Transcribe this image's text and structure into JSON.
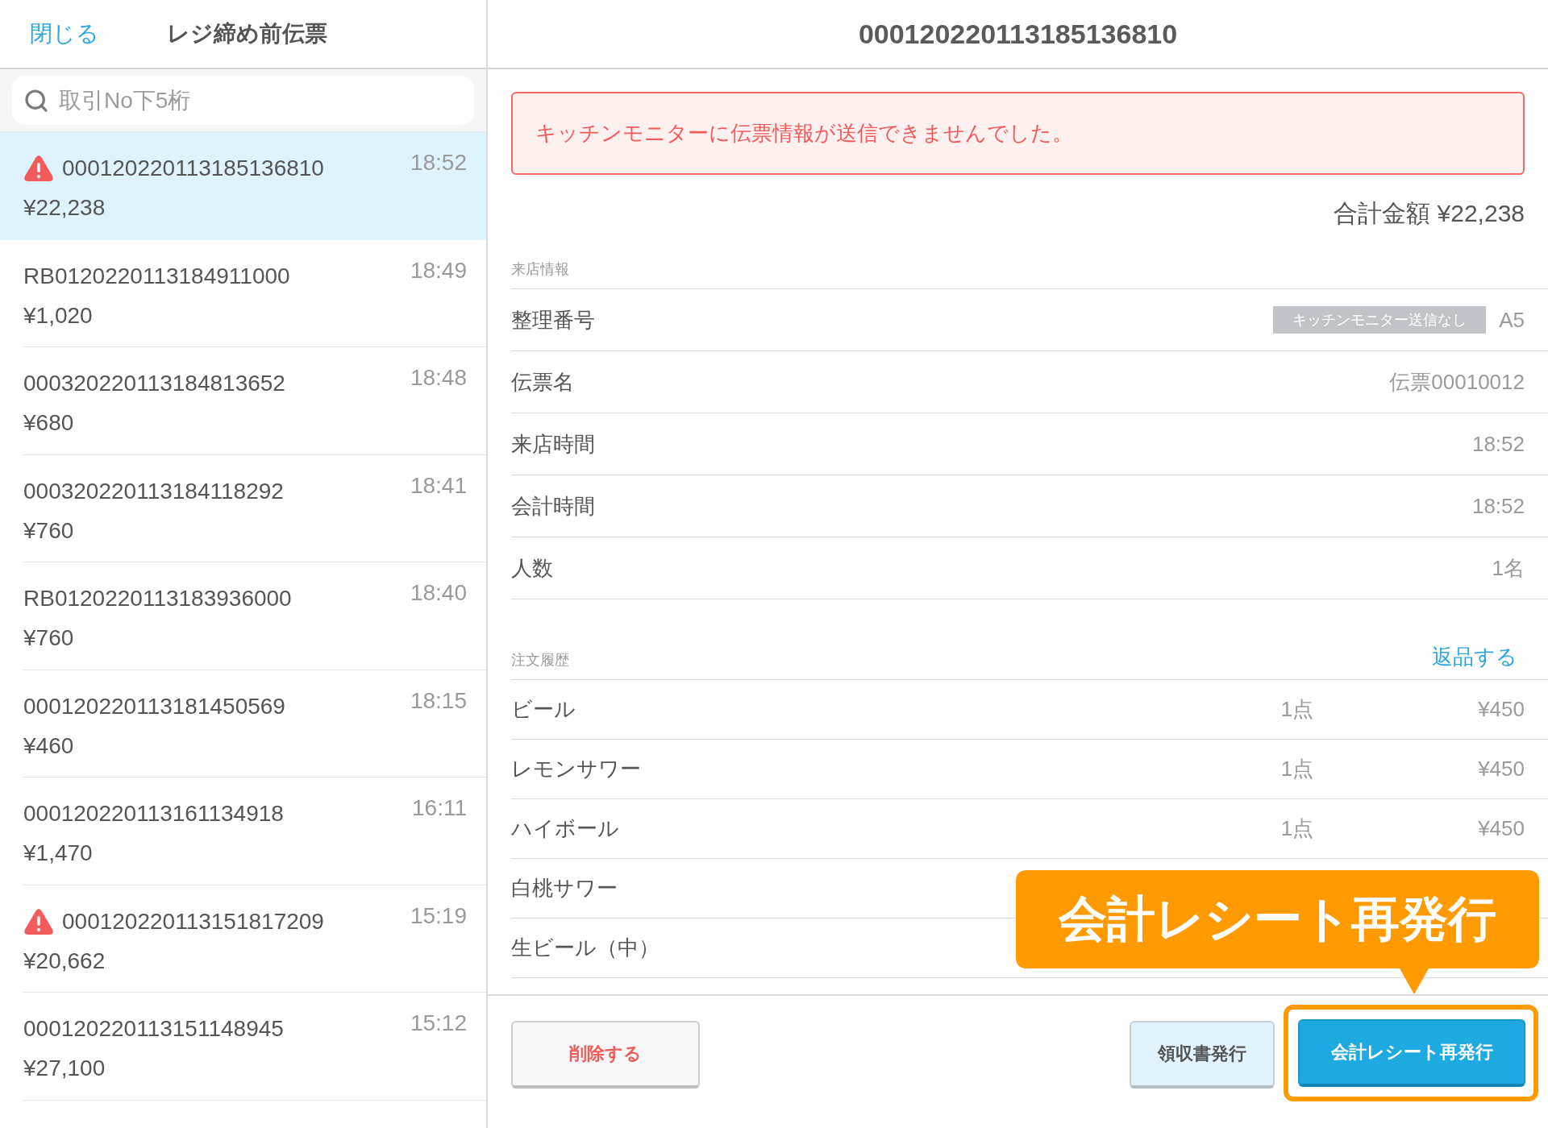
{
  "header": {
    "close_link": "閉じる",
    "title": "レジ締め前伝票",
    "detail_title": "000120220113185136810"
  },
  "search": {
    "placeholder": "取引No下5桁"
  },
  "transactions": [
    {
      "id": "000120220113185136810",
      "amount": "¥22,238",
      "time": "18:52",
      "warning": true,
      "selected": true
    },
    {
      "id": "RB0120220113184911000",
      "amount": "¥1,020",
      "time": "18:49",
      "warning": false,
      "selected": false
    },
    {
      "id": "000320220113184813652",
      "amount": "¥680",
      "time": "18:48",
      "warning": false,
      "selected": false
    },
    {
      "id": "000320220113184118292",
      "amount": "¥760",
      "time": "18:41",
      "warning": false,
      "selected": false
    },
    {
      "id": "RB0120220113183936000",
      "amount": "¥760",
      "time": "18:40",
      "warning": false,
      "selected": false
    },
    {
      "id": "000120220113181450569",
      "amount": "¥460",
      "time": "18:15",
      "warning": false,
      "selected": false
    },
    {
      "id": "000120220113161134918",
      "amount": "¥1,470",
      "time": "16:11",
      "warning": false,
      "selected": false
    },
    {
      "id": "000120220113151817209",
      "amount": "¥20,662",
      "time": "15:19",
      "warning": true,
      "selected": false
    },
    {
      "id": "000120220113151148945",
      "amount": "¥27,100",
      "time": "15:12",
      "warning": false,
      "selected": false
    }
  ],
  "detail": {
    "alert": "キッチンモニターに伝票情報が送信できませんでした。",
    "total": "合計金額 ¥22,238",
    "visit_section": {
      "title": "来店情報",
      "rows": [
        {
          "label": "整理番号",
          "badge": "キッチンモニター送信なし",
          "value": "A5"
        },
        {
          "label": "伝票名",
          "value": "伝票00010012"
        },
        {
          "label": "来店時間",
          "value": "18:52"
        },
        {
          "label": "会計時間",
          "value": "18:52"
        },
        {
          "label": "人数",
          "value": "1名"
        }
      ]
    },
    "order_section": {
      "title": "注文履歴",
      "action": "返品する",
      "items": [
        {
          "name": "ビール",
          "qty": "1点",
          "price": "¥450"
        },
        {
          "name": "レモンサワー",
          "qty": "1点",
          "price": "¥450"
        },
        {
          "name": "ハイボール",
          "qty": "1点",
          "price": "¥450"
        },
        {
          "name": "白桃サワー"
        },
        {
          "name": "生ビール（中）"
        }
      ]
    }
  },
  "footer": {
    "buttons": [
      {
        "label": "削除する",
        "kind": "danger",
        "highlighted": false
      },
      {
        "label": "領収書発行",
        "kind": "secondary",
        "highlighted": false
      },
      {
        "label": "会計レシート再発行",
        "kind": "primary",
        "highlighted": true
      }
    ]
  },
  "callout": {
    "text": "会計レシート再発行"
  }
}
